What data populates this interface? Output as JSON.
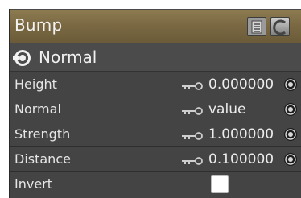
{
  "node": {
    "title": "Bump",
    "header_icons": [
      "list-icon",
      "preview-icon"
    ],
    "section": {
      "icon": "output-connector-icon",
      "title": "Normal"
    },
    "params": [
      {
        "label": "Height",
        "value": "0.000000",
        "key_icon": "key-icon",
        "connector_icon": "connector-icon"
      },
      {
        "label": "Normal",
        "value": "value",
        "key_icon": "key-icon",
        "connector_icon": "connector-icon"
      },
      {
        "label": "Strength",
        "value": "1.000000",
        "key_icon": "key-icon",
        "connector_icon": "connector-icon"
      },
      {
        "label": "Distance",
        "value": "0.100000",
        "key_icon": "key-icon",
        "connector_icon": "connector-icon"
      },
      {
        "label": "Invert",
        "value": "",
        "control": "checkbox",
        "checked": false
      }
    ]
  },
  "colors": {
    "header": "#7a6943",
    "panel": "#4a4a4a",
    "row": "#444444",
    "text": "#e6e6e6"
  }
}
